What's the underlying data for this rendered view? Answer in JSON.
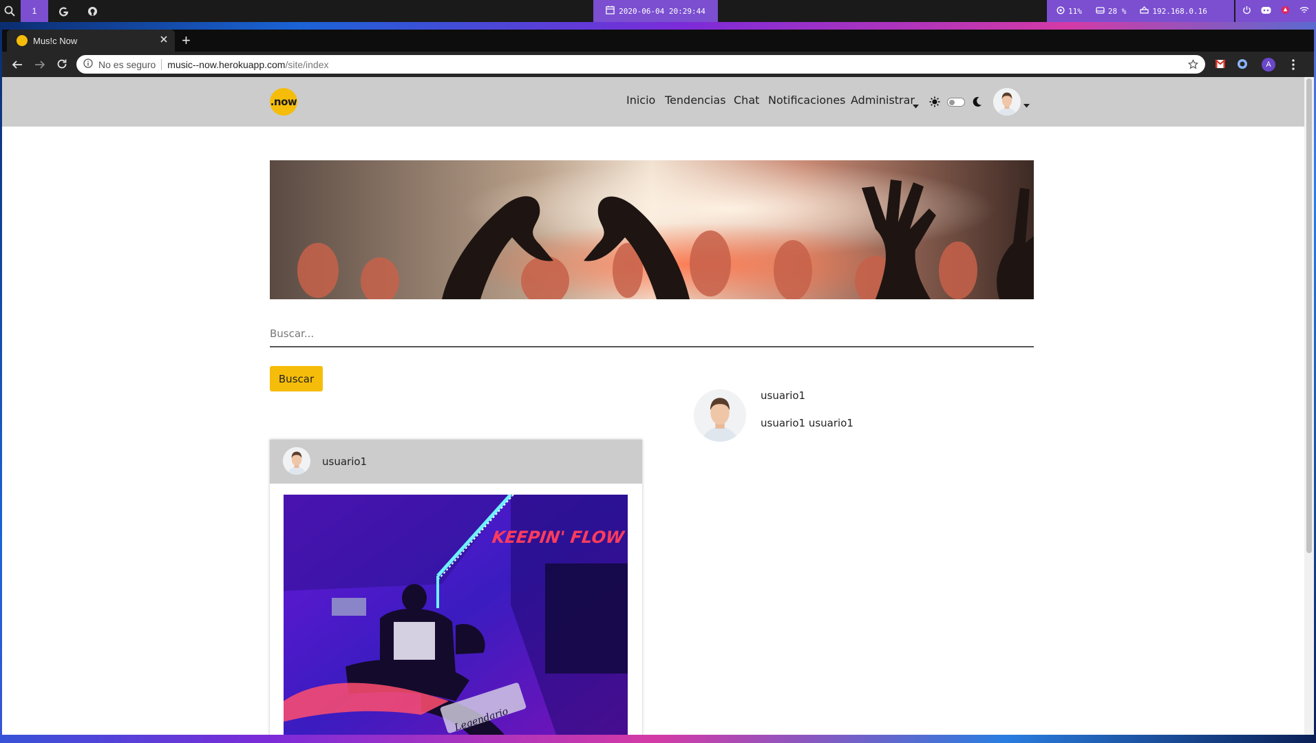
{
  "desktop_bar": {
    "workspace": "1",
    "datetime": "2020-06-04 20:29:44",
    "cpu": "11%",
    "disk": "28 %",
    "ip": "192.168.0.16"
  },
  "browser": {
    "tab_title": "Mus!c Now",
    "new_tab_label": "+",
    "security_label": "No es seguro",
    "url_domain": "music--now.herokuapp.com",
    "url_path": "/site/index",
    "profile_initial": "A"
  },
  "site": {
    "logo_text": ".now",
    "nav": [
      "Inicio",
      "Tendencias",
      "Chat",
      "Notificaciones",
      "Administrar"
    ],
    "search_placeholder": "Buscar...",
    "search_button": "Buscar",
    "post": {
      "author": "usuario1",
      "image_text": "KEEPIN' FLOW",
      "image_caption": "Legendario"
    },
    "profile": {
      "username": "usuario1",
      "full_name": "usuario1 usuario1"
    }
  },
  "colors": {
    "accent": "#f5bd0a",
    "navbar": "#cccccc",
    "panel_purple": "#7b4fd0"
  }
}
